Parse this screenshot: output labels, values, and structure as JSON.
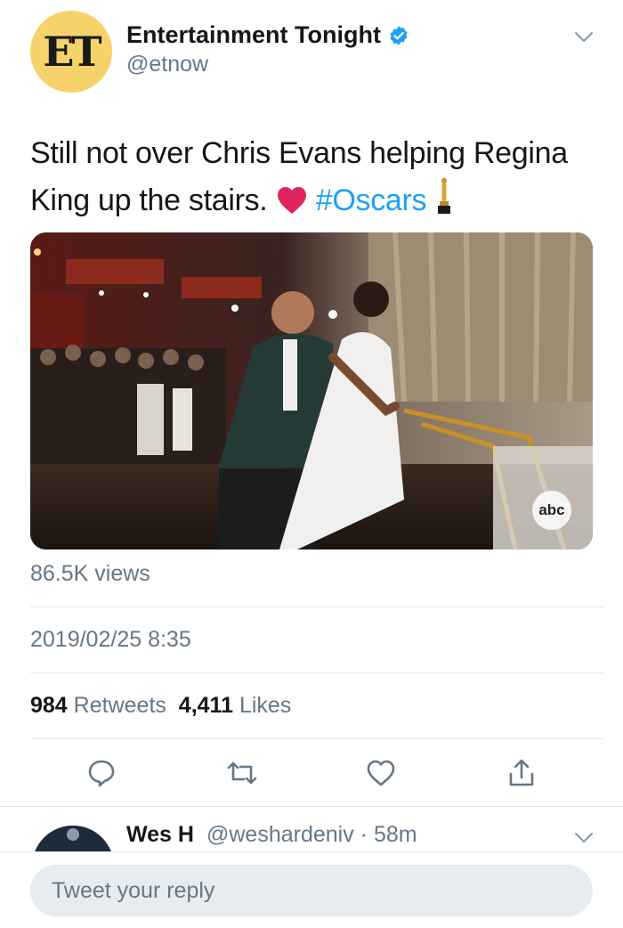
{
  "author": {
    "avatar_text": "ET",
    "display_name": "Entertainment Tonight",
    "handle": "@etnow",
    "verified": true
  },
  "tweet": {
    "text_before": "Still not over Chris Evans helping Regina King up the stairs. ",
    "hashtag": "#Oscars",
    "emoji": [
      "heart",
      "oscar-statuette"
    ]
  },
  "media": {
    "watermark": "abc"
  },
  "meta": {
    "views": "86.5K views",
    "timestamp": "2019/02/25 8:35"
  },
  "stats": {
    "retweets_count": "984",
    "retweets_label": "Retweets",
    "likes_count": "4,411",
    "likes_label": "Likes"
  },
  "actions": [
    "reply-icon",
    "retweet-icon",
    "like-icon",
    "share-icon"
  ],
  "reply_preview": {
    "name": "Wes H",
    "meta": "@weshardeniv · 58m"
  },
  "composer": {
    "placeholder": "Tweet your reply"
  },
  "colors": {
    "accent": "#1da1f2",
    "text": "#14171a",
    "secondary": "#657786",
    "divider": "#e1e8ed",
    "et_yellow": "#f6d36a",
    "heart": "#e0245e"
  }
}
